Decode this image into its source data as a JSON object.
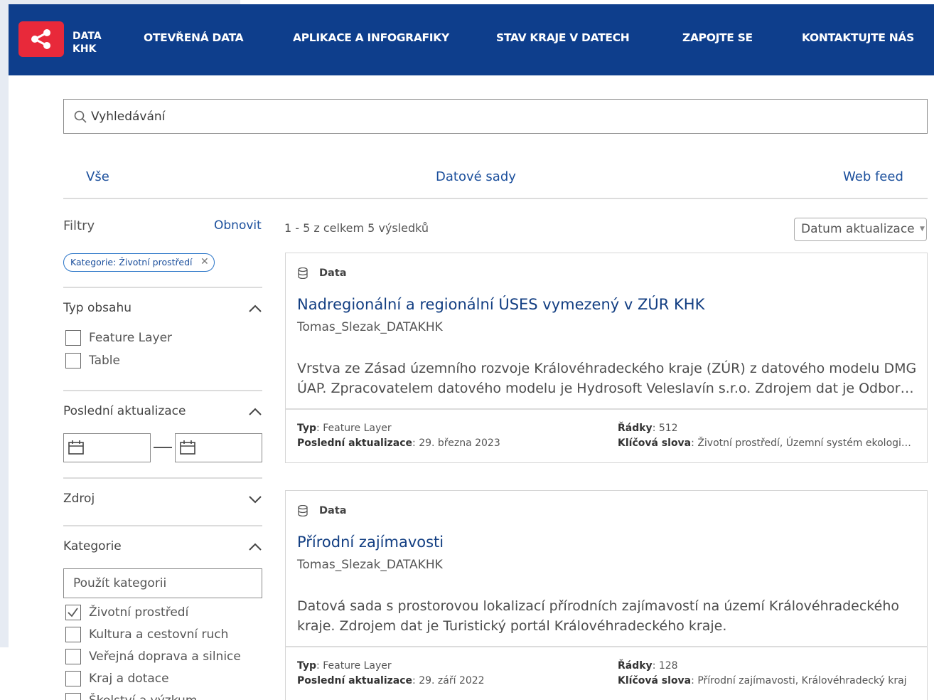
{
  "header": {
    "logo_line1": "DATA",
    "logo_line2": "KHK",
    "nav": [
      "OTEVŘENÁ DATA",
      "APLIKACE A INFOGRAFIKY",
      "STAV KRAJE V DATECH",
      "ZAPOJTE SE",
      "KONTAKTUJTE NÁS"
    ]
  },
  "search": {
    "placeholder": "Vyhledávání"
  },
  "tabs": [
    "Vše",
    "Datové sady",
    "Web feed"
  ],
  "filters": {
    "title": "Filtry",
    "reset_label": "Obnovit",
    "active_chip": "Kategorie: Životní prostředí",
    "content_type": {
      "title": "Typ obsahu",
      "options": [
        "Feature Layer",
        "Table"
      ]
    },
    "last_update": {
      "title": "Poslední aktualizace"
    },
    "source": {
      "title": "Zdroj"
    },
    "category": {
      "title": "Kategorie",
      "input_placeholder": "Použít kategorii",
      "options": [
        {
          "label": "Životní prostředí",
          "checked": true
        },
        {
          "label": "Kultura a cestovní ruch",
          "checked": false
        },
        {
          "label": "Veřejná doprava a silnice",
          "checked": false
        },
        {
          "label": "Kraj a dotace",
          "checked": false
        },
        {
          "label": "Školství a výzkum",
          "checked": false
        }
      ]
    }
  },
  "results": {
    "count_text": "1 - 5 z celkem 5 výsledků",
    "sort_label": "Datum aktualizace",
    "items": [
      {
        "type_label": "Data",
        "title": "Nadregionální a regionální ÚSES vymezený v ZÚR KHK",
        "owner": "Tomas_Slezak_DATAKHK",
        "desc_line1": "Vrstva ze Zásad územního rozvoje Královéhradeckého kraje (ZÚR) z datového modelu DMG",
        "desc_line2": "ÚAP. Zpracovatelem datového modelu je Hydrosoft Veleslavín s.r.o. Zdrojem dat je Odbor…",
        "type_key": "Typ",
        "type_value": "Feature Layer",
        "updated_key": "Poslední aktualizace",
        "updated_value": "29. března 2023",
        "rows_key": "Řádky",
        "rows_value": "512",
        "keywords_key": "Klíčová slova",
        "keywords_value": "Životní prostředí, Územní systém ekologi…"
      },
      {
        "type_label": "Data",
        "title": "Přírodní zajímavosti",
        "owner": "Tomas_Slezak_DATAKHK",
        "desc_line1": "Datová sada s prostorovou lokalizací přírodních zajímavostí na území Královéhradeckého",
        "desc_line2": "kraje. Zdrojem dat je Turistický portál Královéhradeckého kraje.",
        "type_key": "Typ",
        "type_value": "Feature Layer",
        "updated_key": "Poslední aktualizace",
        "updated_value": "29. září 2022",
        "rows_key": "Řádky",
        "rows_value": "128",
        "keywords_key": "Klíčová slova",
        "keywords_value": "Přírodní zajímavosti, Královéhradecký kraj"
      }
    ]
  },
  "colors": {
    "header_bg": "#0e3e8c",
    "logo_bg": "#e8293a",
    "link": "#1b4f9c",
    "title": "#123e82"
  }
}
